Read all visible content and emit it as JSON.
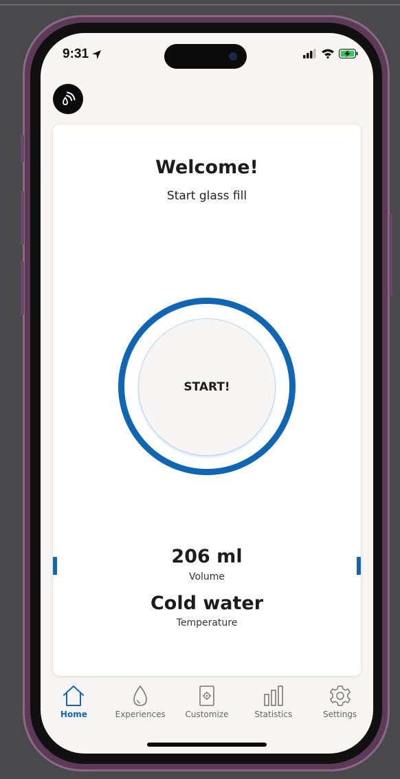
{
  "status_bar": {
    "time": "9:31"
  },
  "card": {
    "title": "Welcome!",
    "subtitle": "Start glass fill",
    "start_label": "START!",
    "volume_value": "206 ml",
    "volume_label": "Volume",
    "temperature_value": "Cold water",
    "temperature_label": "Temperature"
  },
  "tabs": [
    {
      "label": "Home",
      "icon": "home-icon",
      "active": true
    },
    {
      "label": "Experiences",
      "icon": "water-drop-icon",
      "active": false
    },
    {
      "label": "Customize",
      "icon": "customize-icon",
      "active": false
    },
    {
      "label": "Statistics",
      "icon": "bar-chart-icon",
      "active": false
    },
    {
      "label": "Settings",
      "icon": "gear-icon",
      "active": false
    }
  ],
  "colors": {
    "accent": "#1166b3",
    "text": "#1c1c1c",
    "tab_inactive": "#666666"
  }
}
